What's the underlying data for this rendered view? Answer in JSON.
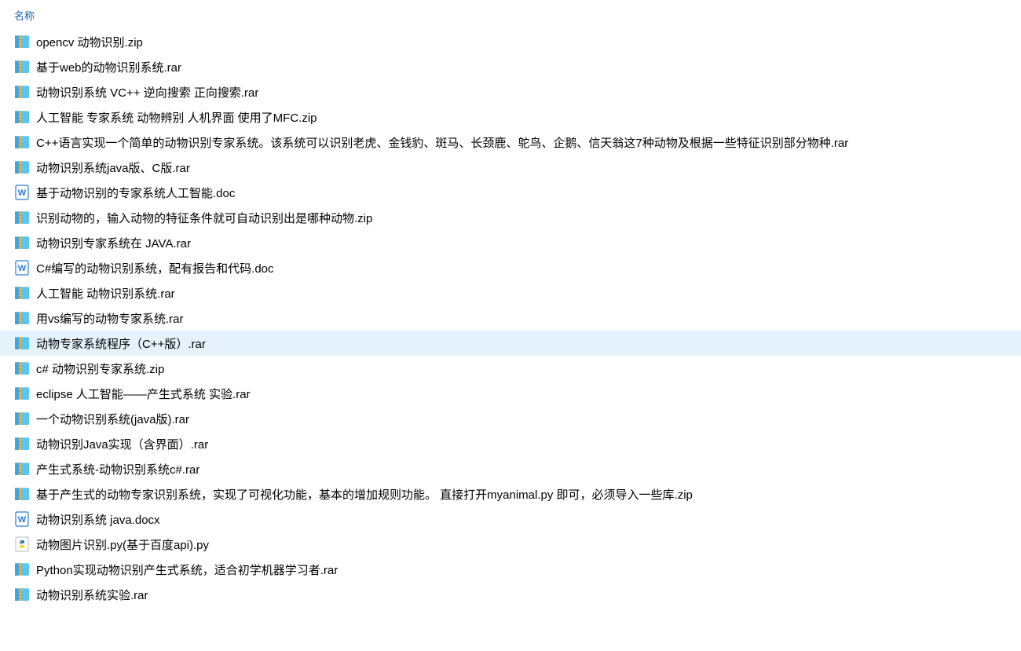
{
  "header": {
    "name_column": "名称"
  },
  "selected_index": 12,
  "files": [
    {
      "name": "opencv 动物识别.zip",
      "icon": "archive"
    },
    {
      "name": "基于web的动物识别系统.rar",
      "icon": "archive"
    },
    {
      "name": "动物识别系统 VC++ 逆向搜索 正向搜索.rar",
      "icon": "archive"
    },
    {
      "name": "人工智能 专家系统 动物辨别 人机界面 使用了MFC.zip",
      "icon": "archive"
    },
    {
      "name": "C++语言实现一个简单的动物识别专家系统。该系统可以识别老虎、金钱豹、斑马、长颈鹿、鸵鸟、企鹅、信天翁这7种动物及根据一些特征识别部分物种.rar",
      "icon": "archive"
    },
    {
      "name": "动物识别系统java版、C版.rar",
      "icon": "archive"
    },
    {
      "name": "基于动物识别的专家系统人工智能.doc",
      "icon": "word"
    },
    {
      "name": "识别动物的，输入动物的特征条件就可自动识别出是哪种动物.zip",
      "icon": "archive"
    },
    {
      "name": "动物识别专家系统在 JAVA.rar",
      "icon": "archive"
    },
    {
      "name": "C#编写的动物识别系统，配有报告和代码.doc",
      "icon": "word"
    },
    {
      "name": "人工智能 动物识别系统.rar",
      "icon": "archive"
    },
    {
      "name": "用vs编写的动物专家系统.rar",
      "icon": "archive"
    },
    {
      "name": "动物专家系统程序（C++版）.rar",
      "icon": "archive"
    },
    {
      "name": "c# 动物识别专家系统.zip",
      "icon": "archive"
    },
    {
      "name": "eclipse 人工智能——产生式系统 实验.rar",
      "icon": "archive"
    },
    {
      "name": "一个动物识别系统(java版).rar",
      "icon": "archive"
    },
    {
      "name": "动物识别Java实现（含界面）.rar",
      "icon": "archive"
    },
    {
      "name": "产生式系统-动物识别系统c#.rar",
      "icon": "archive"
    },
    {
      "name": "基于产生式的动物专家识别系统，实现了可视化功能，基本的增加规则功能。 直接打开myanimal.py 即可，必须导入一些库.zip",
      "icon": "archive"
    },
    {
      "name": "动物识别系统 java.docx",
      "icon": "word"
    },
    {
      "name": "动物图片识别.py(基于百度api).py",
      "icon": "python"
    },
    {
      "name": "Python实现动物识别产生式系统，适合初学机器学习者.rar",
      "icon": "archive"
    },
    {
      "name": "动物识别系统实验.rar",
      "icon": "archive"
    }
  ]
}
